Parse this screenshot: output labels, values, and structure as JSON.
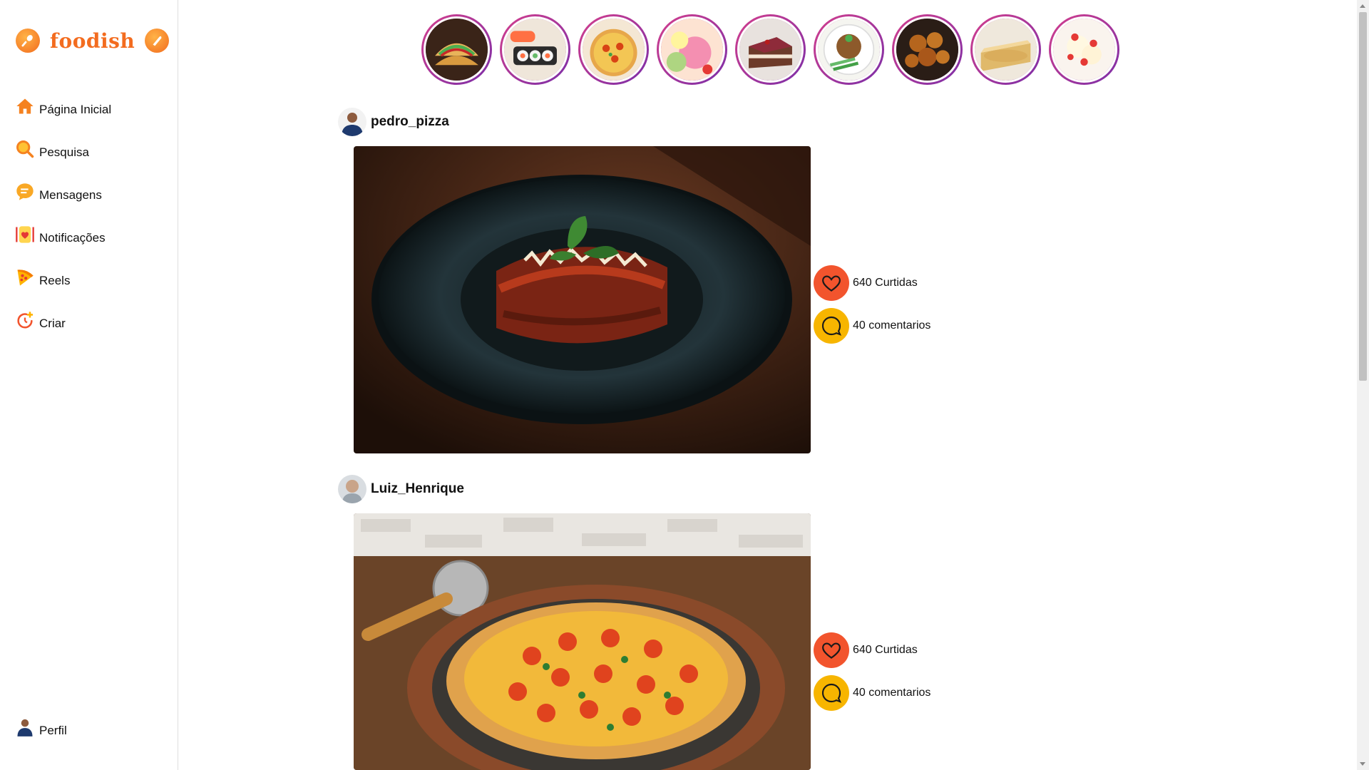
{
  "brand": {
    "name": "foodish",
    "accent": "#f36c1f",
    "like_color": "#f2542d",
    "comment_color": "#f7b500"
  },
  "sidebar": {
    "items": [
      {
        "label": "Página Inicial",
        "icon": "home-icon"
      },
      {
        "label": "Pesquisa",
        "icon": "search-icon"
      },
      {
        "label": "Mensagens",
        "icon": "message-icon"
      },
      {
        "label": "Notificações",
        "icon": "notification-icon"
      },
      {
        "label": "Reels",
        "icon": "pizza-slice-icon"
      },
      {
        "label": "Criar",
        "icon": "create-icon"
      }
    ],
    "profile_label": "Perfil"
  },
  "stories": [
    {
      "name": "story-tacos"
    },
    {
      "name": "story-sushi"
    },
    {
      "name": "story-pizza"
    },
    {
      "name": "story-ice-cream"
    },
    {
      "name": "story-cake"
    },
    {
      "name": "story-rice-dish"
    },
    {
      "name": "story-fried-snacks"
    },
    {
      "name": "story-pie"
    },
    {
      "name": "story-strawberry-dessert"
    }
  ],
  "posts": [
    {
      "username": "pedro_pizza",
      "likes_label": "640 Curtidas",
      "comments_label": "40 comentarios"
    },
    {
      "username": "Luiz_Henrique",
      "likes_label": "640 Curtidas",
      "comments_label": "40 comentarios"
    }
  ]
}
